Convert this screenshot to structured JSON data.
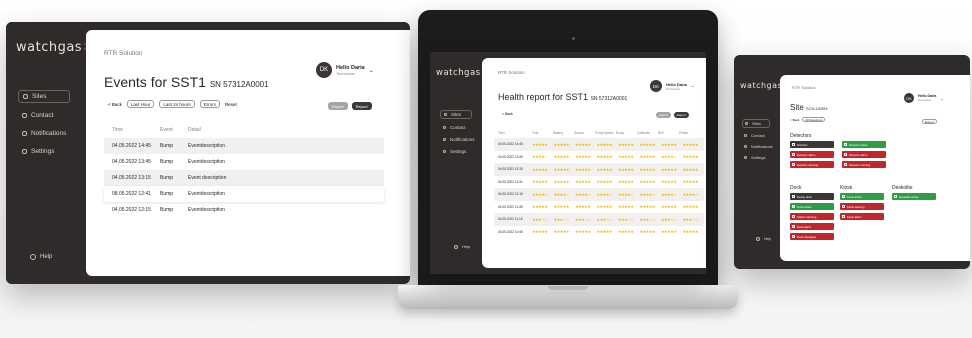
{
  "brand": {
    "logo_text": "watchgas",
    "logo_mark": "✕"
  },
  "nav": {
    "sites": "Sites",
    "contact": "Contact",
    "notifications": "Notifications",
    "settings": "Settings",
    "help": "Help"
  },
  "user": {
    "initials": "DK",
    "name": "Hello Daria",
    "role": "Technician"
  },
  "events_screen": {
    "breadcrumb": "RTR Solution",
    "title": "Events for SST1",
    "serial": "SN 57312A0001",
    "back": "< Back",
    "filters": [
      "Last Hour",
      "Last 24 hours",
      "Errors",
      "Reset"
    ],
    "actions": [
      "Export",
      "Report"
    ],
    "columns": [
      "Time",
      "Event",
      "Detail"
    ],
    "rows": [
      {
        "time": "04.05.2022 14:45",
        "event": "Bump",
        "detail": "Eventdescription"
      },
      {
        "time": "04.05.2022 13:45",
        "event": "Bump",
        "detail": "Eventdescription"
      },
      {
        "time": "04.05.2022 13:15",
        "event": "Bump",
        "detail": "Event description"
      },
      {
        "time": "08.05.2022 12:41",
        "event": "Bump",
        "detail": "Eventdescription"
      },
      {
        "time": "04.05.2022 12:15",
        "event": "Bump",
        "detail": "Eventdescription"
      }
    ]
  },
  "health_screen": {
    "breadcrumb": "RTR Solution",
    "title": "Health report for SST1",
    "serial": "SN 57312A0001",
    "back": "< Back",
    "actions": [
      "Export",
      "Report"
    ],
    "columns": [
      "Time",
      "Tnet",
      "Battery",
      "Sensor",
      "Pump/Valves",
      "Bump",
      "Calibrate",
      "BLE",
      "Printer"
    ],
    "rows": [
      {
        "time": "04.05.2022 14:45",
        "ratings": [
          5,
          5,
          5,
          5,
          5,
          5,
          5,
          5
        ]
      },
      {
        "time": "04.05.2022 13:45",
        "ratings": [
          4,
          5,
          5,
          5,
          5,
          5,
          4,
          5
        ]
      },
      {
        "time": "04.05.2022 13:15",
        "ratings": [
          5,
          5,
          5,
          5,
          5,
          5,
          5,
          5
        ]
      },
      {
        "time": "04.05.2022 12:41",
        "ratings": [
          5,
          5,
          5,
          5,
          5,
          5,
          5,
          5
        ]
      },
      {
        "time": "04.05.2022 12:15",
        "ratings": [
          4,
          4,
          4,
          4,
          4,
          4,
          4,
          4
        ]
      },
      {
        "time": "04.05.2022 11:45",
        "ratings": [
          5,
          5,
          5,
          5,
          5,
          5,
          5,
          5
        ]
      },
      {
        "time": "04.05.2022 11:15",
        "ratings": [
          3,
          3,
          3,
          3,
          3,
          3,
          3,
          3
        ]
      },
      {
        "time": "04.05.2022 10:45",
        "ratings": [
          5,
          5,
          5,
          5,
          5,
          5,
          5,
          5
        ]
      }
    ]
  },
  "site_screen": {
    "breadcrumb": "RTR Solution",
    "title": "Site",
    "serial": "SCH-U0394",
    "back": "< Back",
    "filter": "All Detectors",
    "action": "Export",
    "sections": {
      "detectors": "Detectors",
      "dock": "Dock",
      "kiosk": "Kiosk",
      "deskolite": "Deskolite"
    },
    "tiles": {
      "detectors": [
        {
          "label": "Detector",
          "color": "dark"
        },
        {
          "label": "Detector active",
          "color": "green"
        },
        {
          "label": "Detector alarm",
          "color": "red"
        },
        {
          "label": "Detector alarm",
          "color": "red"
        },
        {
          "label": "Detector warning",
          "color": "red"
        },
        {
          "label": "Detector warning",
          "color": "red"
        }
      ],
      "dock": [
        {
          "label": "Ready dock",
          "color": "dark"
        },
        {
          "label": "Dock active",
          "color": "green"
        },
        {
          "label": "Station warning",
          "color": "red"
        },
        {
          "label": "Dock alarm",
          "color": "red"
        },
        {
          "label": "Dock damaged",
          "color": "red"
        }
      ],
      "kiosk": [
        {
          "label": "Kiosk active",
          "color": "green"
        },
        {
          "label": "Kiosk warning",
          "color": "red"
        },
        {
          "label": "Kiosk alarm",
          "color": "red"
        }
      ],
      "deskolite": [
        {
          "label": "Deskolite active",
          "color": "green"
        }
      ]
    }
  }
}
